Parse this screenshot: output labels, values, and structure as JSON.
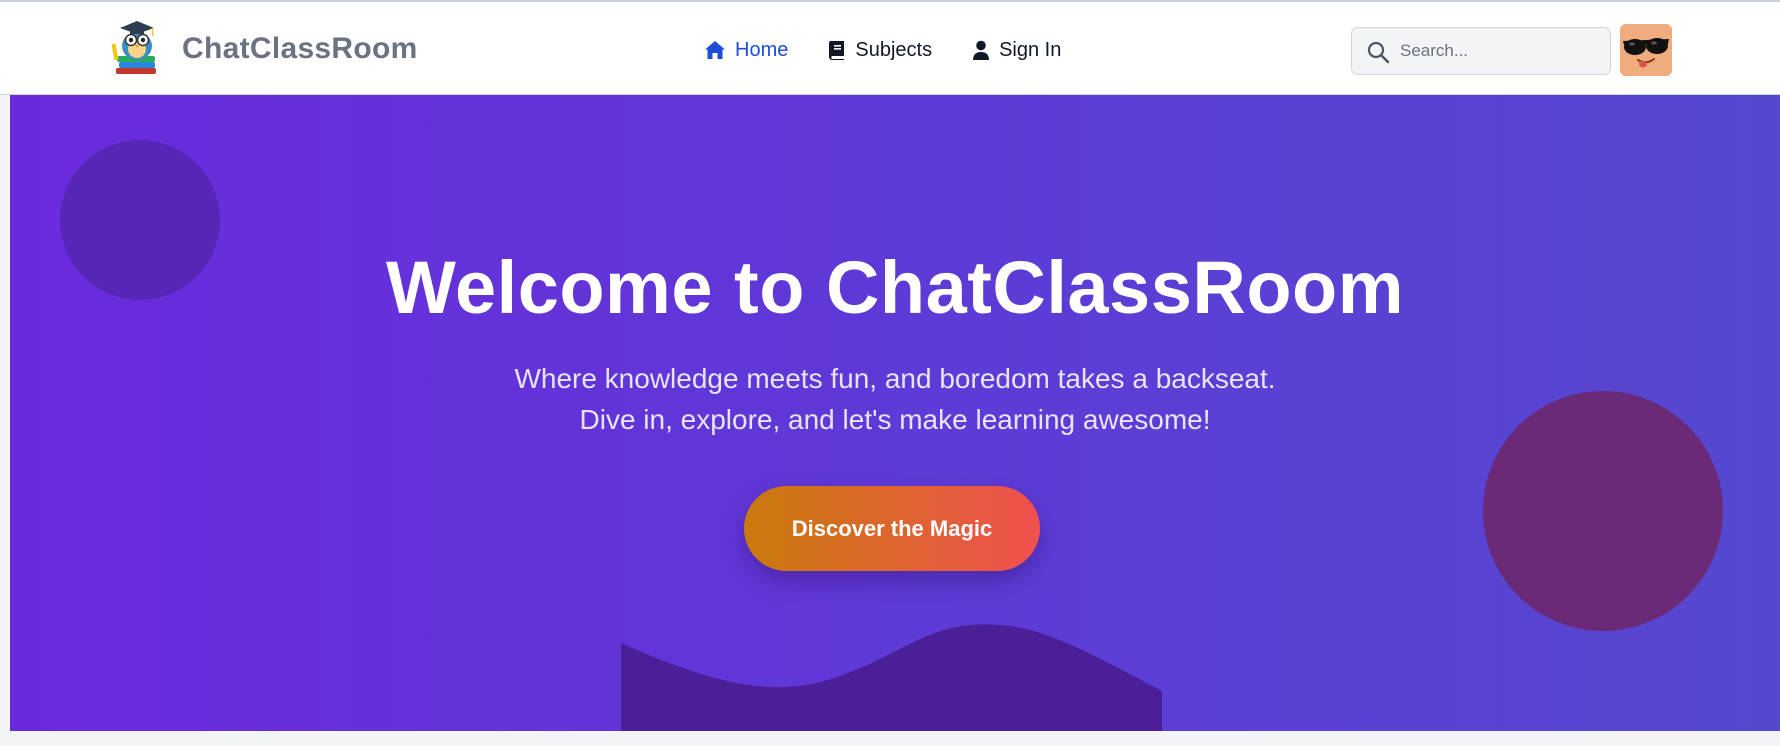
{
  "navbar": {
    "brand_name": "ChatClassRoom",
    "logo_icon": "owl-graduate-logo",
    "links": [
      {
        "label": "Home",
        "icon": "home-icon",
        "active": true
      },
      {
        "label": "Subjects",
        "icon": "book-icon",
        "active": false
      },
      {
        "label": "Sign In",
        "icon": "user-icon",
        "active": false
      }
    ],
    "search": {
      "placeholder": "Search...",
      "value": ""
    },
    "avatar_icon": "sunglasses-emoji-avatar"
  },
  "hero": {
    "title": "Welcome to ChatClassRoom",
    "subtitle_line1": "Where knowledge meets fun, and boredom takes a backseat.",
    "subtitle_line2": "Dive in, explore, and let's make learning awesome!",
    "cta_label": "Discover the Magic"
  },
  "colors": {
    "hero_gradient_start": "#6a2adc",
    "hero_gradient_end": "#5548cf",
    "cta_gradient_start": "#c97a0c",
    "cta_gradient_end": "#f0504f",
    "active_link": "#1d4ed8",
    "brand_text": "#6b7280"
  }
}
